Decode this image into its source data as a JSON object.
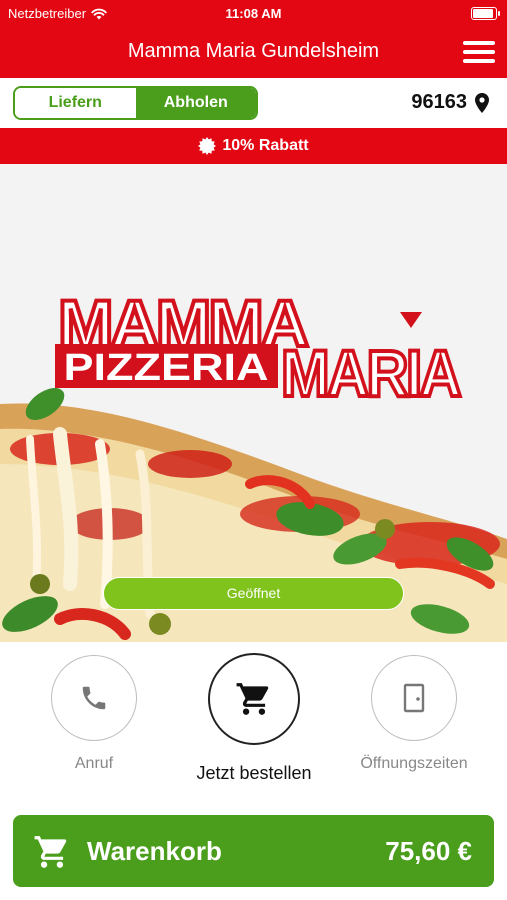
{
  "status_bar": {
    "carrier": "Netzbetreiber",
    "time": "11:08 AM",
    "battery_level": 0.9
  },
  "header": {
    "title": "Mamma Maria Gundelsheim"
  },
  "delivery": {
    "deliver_label": "Liefern",
    "pickup_label": "Abholen",
    "selected": "Abholen",
    "postcode": "96163"
  },
  "discount": {
    "label": "10% Rabatt"
  },
  "hero": {
    "logo_line1": "MAMMA",
    "logo_line2": "MARIA",
    "logo_band": "PIZZERIA",
    "open_status": "Geöffnet"
  },
  "actions": {
    "call_label": "Anruf",
    "order_label": "Jetzt bestellen",
    "hours_label": "Öffnungszeiten"
  },
  "cart": {
    "label": "Warenkorb",
    "total": "75,60 €"
  },
  "colors": {
    "brand_red": "#e30613",
    "brand_green": "#4a9e1c",
    "status_green": "#7fc31c"
  },
  "icons": [
    "wifi-icon",
    "battery-icon",
    "menu-icon",
    "location-pin-icon",
    "badge-icon",
    "phone-icon",
    "cart-icon",
    "door-icon"
  ]
}
